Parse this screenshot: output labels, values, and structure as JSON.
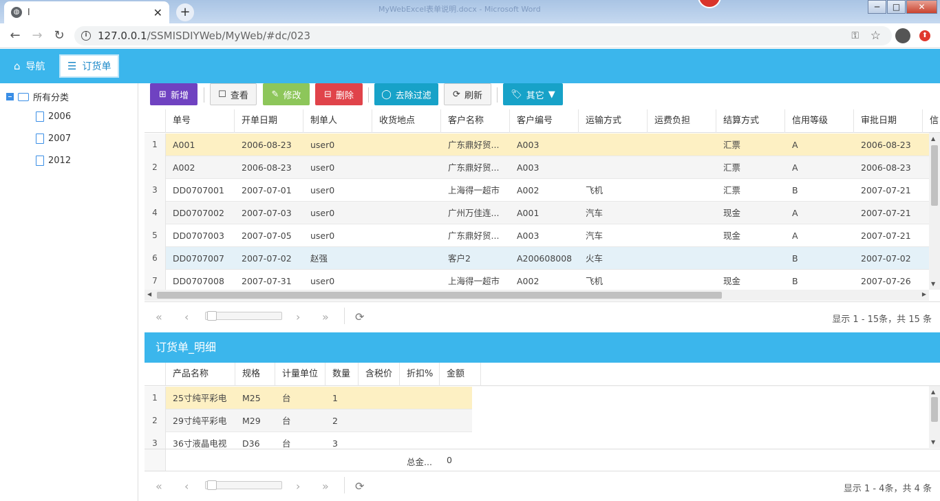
{
  "browser": {
    "tab_title": "l",
    "window_title": "MyWebExcel表单说明.docx - Microsoft Word",
    "url_host": "127.0.0.1",
    "url_path": "/SSMISDIYWeb/MyWeb/#dc/023",
    "win_buttons": [
      "─",
      "□",
      "✕"
    ]
  },
  "apptabs": [
    {
      "label": "导航",
      "icon": "home-icon"
    },
    {
      "label": "订货单",
      "icon": "menu-icon"
    }
  ],
  "tree": {
    "root": "所有分类",
    "children": [
      "2006",
      "2007",
      "2012"
    ]
  },
  "toolbar": {
    "add": "新增",
    "view": "查看",
    "edit": "修改",
    "delete": "删除",
    "clear_filter": "去除过滤",
    "refresh": "刷新",
    "other": "其它"
  },
  "colors": {
    "accent": "#3bb6ec",
    "add": "#6f42c1",
    "edit": "#8dc65a",
    "delete": "#e0434a",
    "info": "#17a2c8"
  },
  "grid": {
    "columns": [
      "单号",
      "开单日期",
      "制单人",
      "收货地点",
      "客户名称",
      "客户编号",
      "运输方式",
      "运费负担",
      "结算方式",
      "信用等级",
      "审批日期",
      "信"
    ],
    "rows": [
      {
        "n": "1",
        "c": [
          "A001",
          "2006-08-23",
          "user0",
          "",
          "广东鼎好贸...",
          "A003",
          "",
          "",
          "汇票",
          "A",
          "2006-08-23"
        ]
      },
      {
        "n": "2",
        "c": [
          "A002",
          "2006-08-23",
          "user0",
          "",
          "广东鼎好贸...",
          "A003",
          "",
          "",
          "汇票",
          "A",
          "2006-08-23"
        ]
      },
      {
        "n": "3",
        "c": [
          "DD0707001",
          "2007-07-01",
          "user0",
          "",
          "上海得一超市",
          "A002",
          "飞机",
          "",
          "汇票",
          "B",
          "2007-07-21"
        ]
      },
      {
        "n": "4",
        "c": [
          "DD0707002",
          "2007-07-03",
          "user0",
          "",
          "广州万佳连...",
          "A001",
          "汽车",
          "",
          "现金",
          "A",
          "2007-07-21"
        ]
      },
      {
        "n": "5",
        "c": [
          "DD0707003",
          "2007-07-05",
          "user0",
          "",
          "广东鼎好贸...",
          "A003",
          "汽车",
          "",
          "现金",
          "A",
          "2007-07-21"
        ]
      },
      {
        "n": "6",
        "c": [
          "DD0707007",
          "2007-07-02",
          "赵强",
          "",
          "客户2",
          "A200608008",
          "火车",
          "",
          "",
          "B",
          "2007-07-02"
        ]
      },
      {
        "n": "7",
        "c": [
          "DD0707008",
          "2007-07-31",
          "user0",
          "",
          "上海得一超市",
          "A002",
          "飞机",
          "",
          "现金",
          "B",
          "2007-07-26"
        ]
      }
    ],
    "pager_info": "显示 1 - 15条，共 15 条"
  },
  "detail": {
    "title": "订货单_明细",
    "columns": [
      "产品名称",
      "规格",
      "计量单位",
      "数量",
      "含税价",
      "折扣%",
      "金额"
    ],
    "rows": [
      {
        "n": "1",
        "c": [
          "25寸纯平彩电",
          "M25",
          "台",
          "1"
        ]
      },
      {
        "n": "2",
        "c": [
          "29寸纯平彩电",
          "M29",
          "台",
          "2"
        ]
      },
      {
        "n": "3",
        "c": [
          "36寸液晶电视",
          "D36",
          "台",
          "3"
        ]
      }
    ],
    "footer_label": "总金...",
    "footer_value": "0",
    "pager_info": "显示 1 - 4条，共 4 条"
  }
}
